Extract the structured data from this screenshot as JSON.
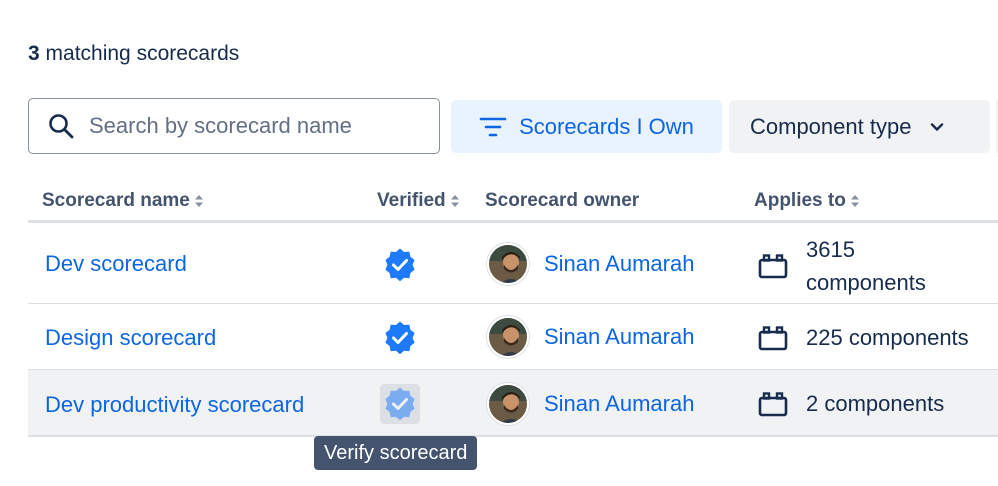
{
  "summary": {
    "count": "3",
    "label": "matching scorecards"
  },
  "search": {
    "placeholder": "Search by scorecard name",
    "icon": "search-icon"
  },
  "filters": {
    "own_label": "Scorecards I Own",
    "type_label": "Component type"
  },
  "columns": {
    "name": "Scorecard name",
    "verified": "Verified",
    "owner": "Scorecard owner",
    "applies": "Applies to"
  },
  "rows": [
    {
      "name": "Dev scorecard",
      "verified": true,
      "owner": "Sinan Aumarah",
      "applies_line1": "3615",
      "applies_line2": "components"
    },
    {
      "name": "Design scorecard",
      "verified": true,
      "owner": "Sinan Aumarah",
      "applies": "225 components"
    },
    {
      "name": "Dev productivity scorecard",
      "verified": false,
      "owner": "Sinan Aumarah",
      "applies": "2 components"
    }
  ],
  "tooltip": {
    "text": "Verify scorecard"
  },
  "colors": {
    "link": "#0c66e4",
    "verified": "#1d7afc",
    "text": "#172b4d",
    "accent_bg": "#e9f2ff"
  }
}
